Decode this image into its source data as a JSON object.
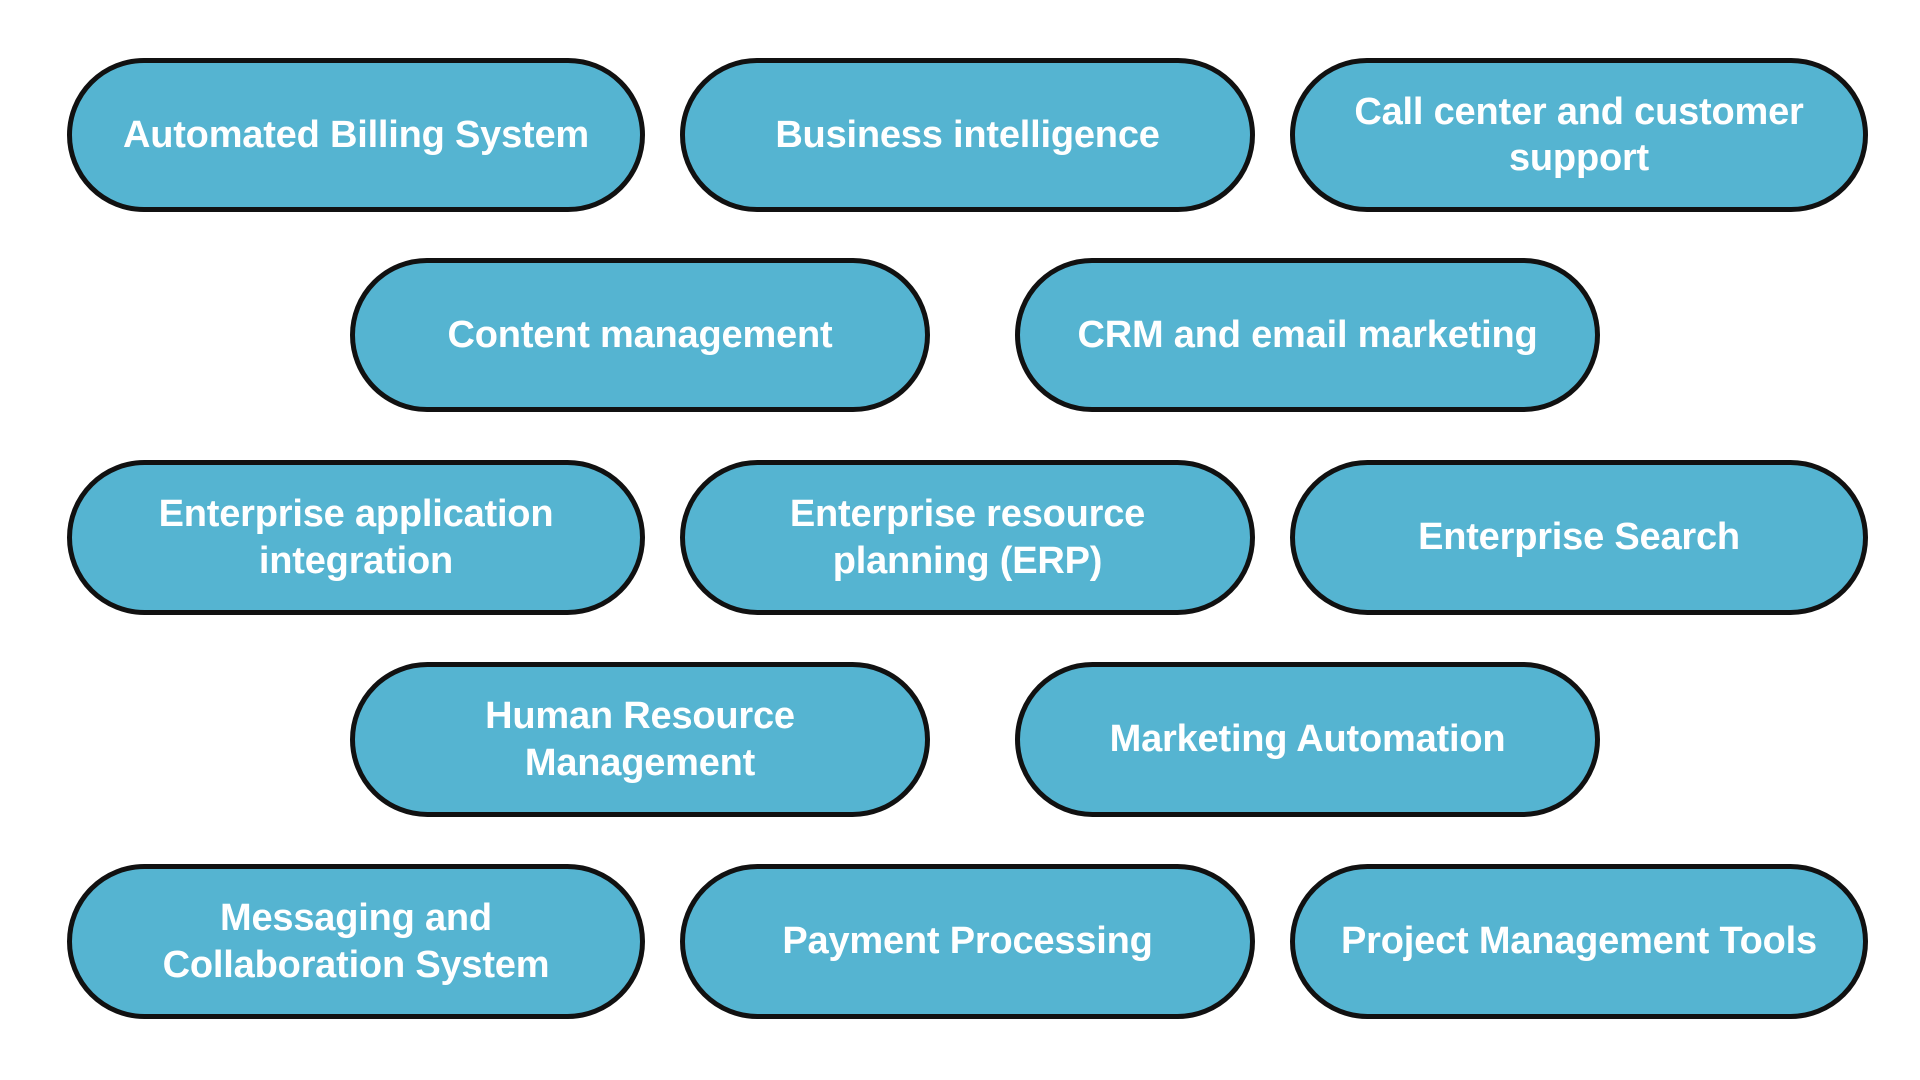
{
  "page": {
    "background_color": "#ffffff",
    "pill_fill_color": "#55b4d1",
    "pill_border_color": "#111111",
    "pill_text_color": "#ffffff"
  },
  "diagram": {
    "type": "pill-grid",
    "rows": [
      {
        "alignment": "full",
        "items": [
          {
            "label": "Automated Billing System"
          },
          {
            "label": "Business intelligence"
          },
          {
            "label": "Call center and customer\nsupport"
          }
        ]
      },
      {
        "alignment": "indented",
        "items": [
          {
            "label": "Content management"
          },
          {
            "label": "CRM and email marketing"
          }
        ]
      },
      {
        "alignment": "full",
        "items": [
          {
            "label": "Enterprise application\nintegration"
          },
          {
            "label": "Enterprise resource\nplanning (ERP)"
          },
          {
            "label": "Enterprise Search"
          }
        ]
      },
      {
        "alignment": "indented",
        "items": [
          {
            "label": "Human Resource\nManagement"
          },
          {
            "label": "Marketing Automation"
          }
        ]
      },
      {
        "alignment": "full",
        "items": [
          {
            "label": "Messaging and\nCollaboration System"
          },
          {
            "label": "Payment Processing"
          },
          {
            "label": "Project Management Tools"
          }
        ]
      }
    ]
  }
}
